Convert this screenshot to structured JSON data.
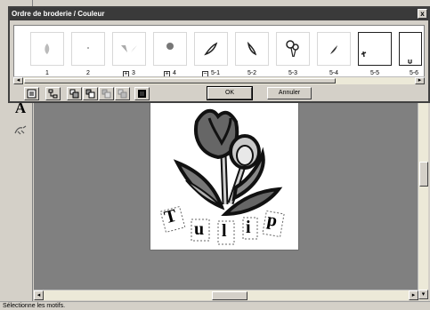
{
  "dialog": {
    "title": "Ordre de broderie / Couleur",
    "close_glyph": "x",
    "thumbnails": [
      {
        "label": "1",
        "group": ""
      },
      {
        "label": "2",
        "group": ""
      },
      {
        "label": "3",
        "group": "+"
      },
      {
        "label": "4",
        "group": "+"
      },
      {
        "label": "5-1",
        "group": "−"
      },
      {
        "label": "5-2",
        "group": ""
      },
      {
        "label": "5-3",
        "group": ""
      },
      {
        "label": "5-4",
        "group": ""
      },
      {
        "label": "5-5",
        "group": ""
      },
      {
        "label": "5-6",
        "group": ""
      }
    ],
    "ok_label": "OK",
    "cancel_label": "Annuler"
  },
  "canvas": {
    "letters": [
      "T",
      "u",
      "l",
      "i",
      "p"
    ]
  },
  "toolbar": {
    "text_tool_glyph": "A"
  },
  "statusbar": {
    "text": "Sélectionne les motifs."
  }
}
